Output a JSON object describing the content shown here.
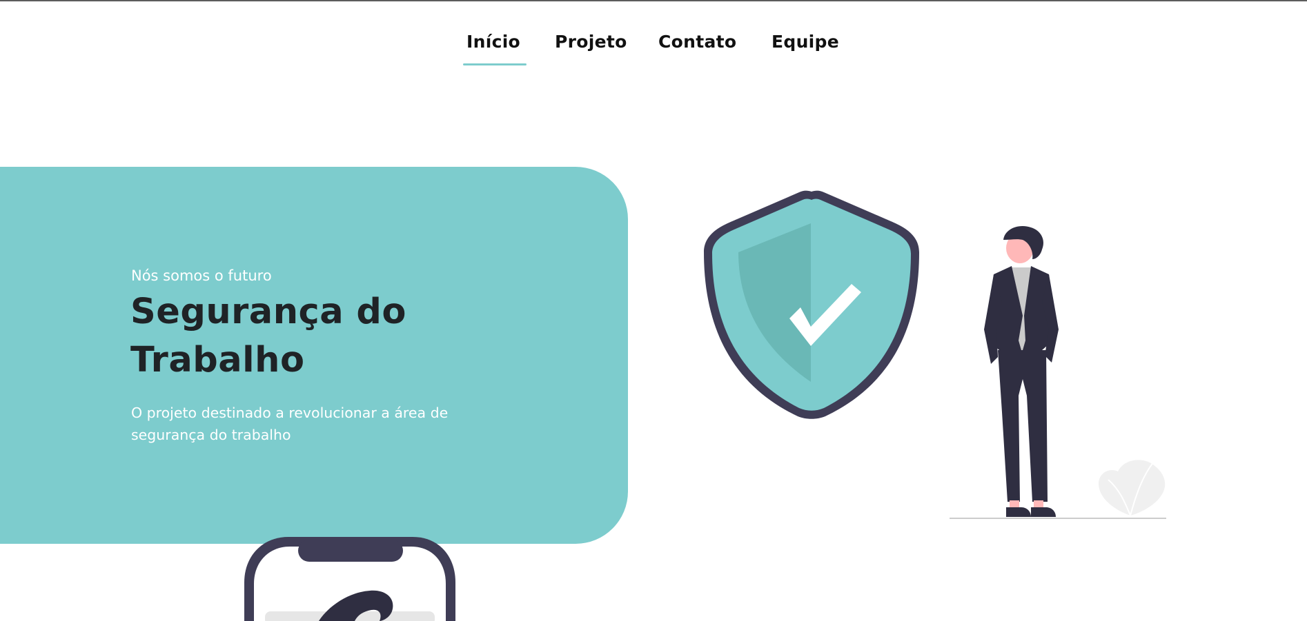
{
  "nav": {
    "items": [
      {
        "label": "Início",
        "active": true
      },
      {
        "label": "Projeto",
        "active": false
      },
      {
        "label": "Contato",
        "active": false
      },
      {
        "label": "Equipe",
        "active": false
      }
    ]
  },
  "hero": {
    "subtitle": "Nós somos o futuro",
    "title_line1": "Segurança do",
    "title_line2": "Trabalho",
    "description": "O projeto destinado a revolucionar a área de segurança do trabalho"
  },
  "colors": {
    "accent": "#7dcccd",
    "accent_dark": "#6ab8b6",
    "title": "#1f2326",
    "outline": "#3f3d56",
    "suit": "#2f2e41",
    "skin": "#ffb8b8"
  },
  "icons": {
    "shield": "shield-check-icon",
    "person": "person-illustration",
    "phone": "phone-illustration"
  }
}
